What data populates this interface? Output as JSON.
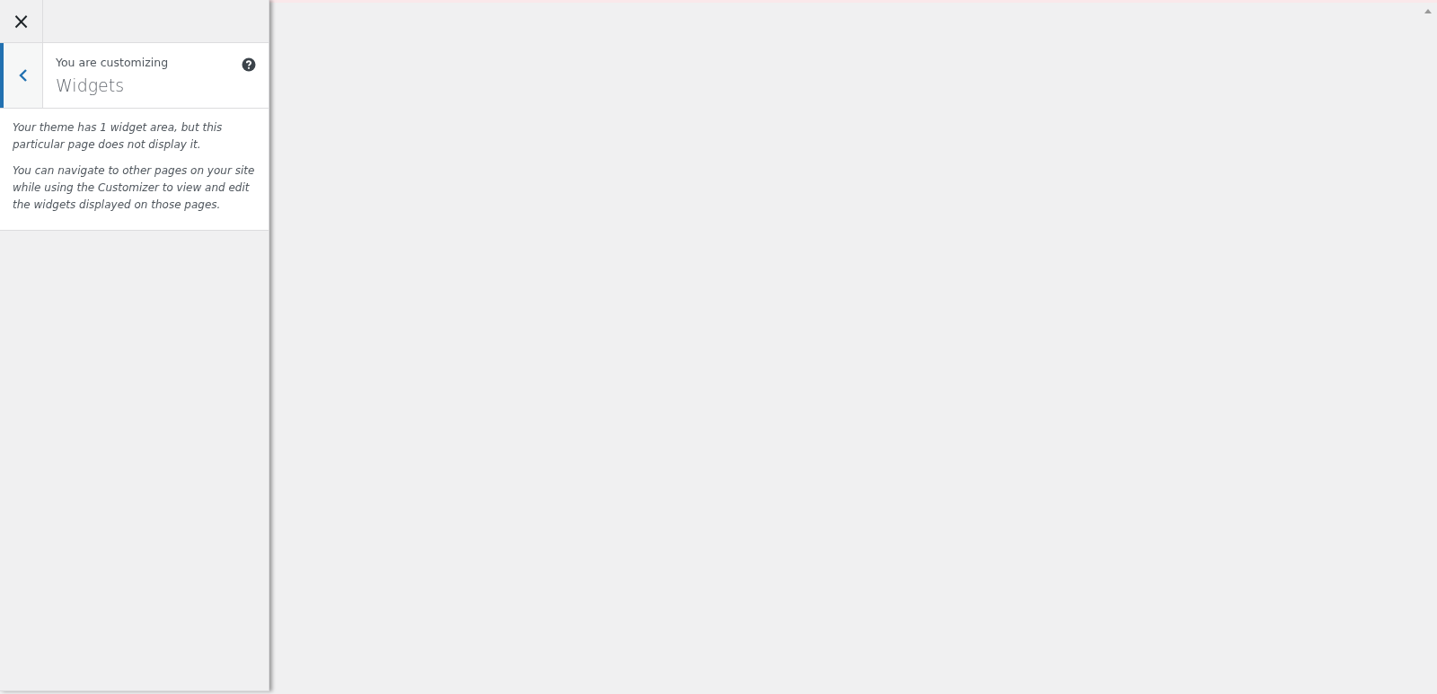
{
  "sidebar": {
    "close_button": "×",
    "header": {
      "subtitle": "You are customizing",
      "title": "Widgets"
    },
    "description": [
      "Your theme has 1 widget area, but this particular page does not display it.",
      "You can navigate to other pages on your site while using the Customizer to view and edit the widgets displayed on those pages."
    ]
  }
}
